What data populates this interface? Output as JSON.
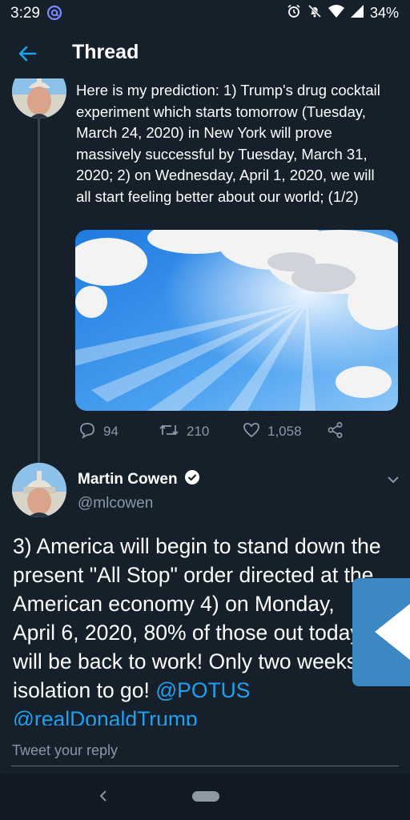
{
  "status_bar": {
    "time": "3:29",
    "battery": "34%"
  },
  "header": {
    "title": "Thread"
  },
  "tweet1": {
    "text": "Here is my prediction: 1) Trump's drug cocktail experiment which starts tomorrow (Tuesday, March 24, 2020) in New York will prove massively successful by Tuesday, March 31, 2020; 2) on Wednesday, April 1, 2020, we will all start feeling better about our world; (1/2)",
    "replies": "94",
    "retweets": "210",
    "likes": "1,058"
  },
  "tweet2": {
    "name": "Martin Cowen",
    "handle": "@mlcowen",
    "text_part": "3) America will begin to stand down the present \"All Stop\" order directed at the American economy 4) on Monday, April 6, 2020, 80% of those out today will be back to work! Only two weeks of isolation to go! ",
    "mention1": "@POTUS",
    "mention2": "@realDonaldTrump"
  },
  "reply": {
    "placeholder": "Tweet your reply"
  },
  "colors": {
    "background": "#15202b",
    "accent": "#1da1f2",
    "secondary_text": "#8899a6",
    "side_tab": "#3b88c3"
  },
  "icons": [
    "at-sign-icon",
    "alarm-icon",
    "notifications-off-icon",
    "wifi-icon",
    "signal-icon",
    "back-arrow-icon",
    "reply-icon",
    "retweet-icon",
    "like-icon",
    "share-icon",
    "verified-badge-icon",
    "chevron-down-icon",
    "nav-back-icon",
    "home-pill-icon"
  ]
}
